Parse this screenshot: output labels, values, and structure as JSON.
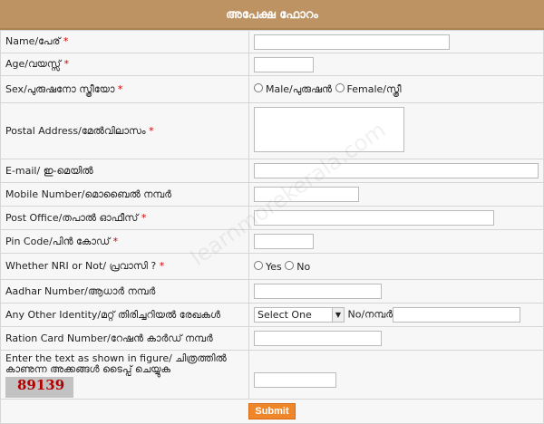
{
  "title": "അപേക്ഷ ഫോറം",
  "watermark": "learnmorekerala.com",
  "fields": {
    "name": "Name/പേര്",
    "age": "Age/വയസ്സ്",
    "sex": "Sex/പുരുഷനോ സ്ത്രീയോ",
    "male": "Male/പുരുഷൻ",
    "female": "Female/സ്ത്രീ",
    "address": "Postal Address/മേൽവിലാസം",
    "email": "E-mail/ ഇ-മെയിൽ",
    "mobile": "Mobile Number/മൊബൈൽ നമ്പർ",
    "post_office": "Post Office/തപാൽ ഓഫീസ്",
    "pin": "Pin Code/പിൻ കോഡ്",
    "nri": "Whether NRI or Not/ പ്രവാസി ?",
    "yes": "Yes",
    "no": "No",
    "aadhar": "Aadhar Number/ആധാർ നമ്പർ",
    "other_id": "Any Other Identity/മറ്റ് തിരിച്ചറിയൽ രേഖകൾ",
    "select_value": "Select One",
    "no_label": "No/നമ്പർ",
    "ration": "Ration Card Number/റേഷൻ കാർഡ് നമ്പർ",
    "captcha_label": "Enter the text as shown in figure/ ചിത്രത്തിൽ കാണുന്ന അക്കങ്ങൾ ടൈപ്പ് ചെയ്യുക",
    "captcha_code": "89139"
  },
  "required_mark": "*",
  "submit_label": "Submit"
}
